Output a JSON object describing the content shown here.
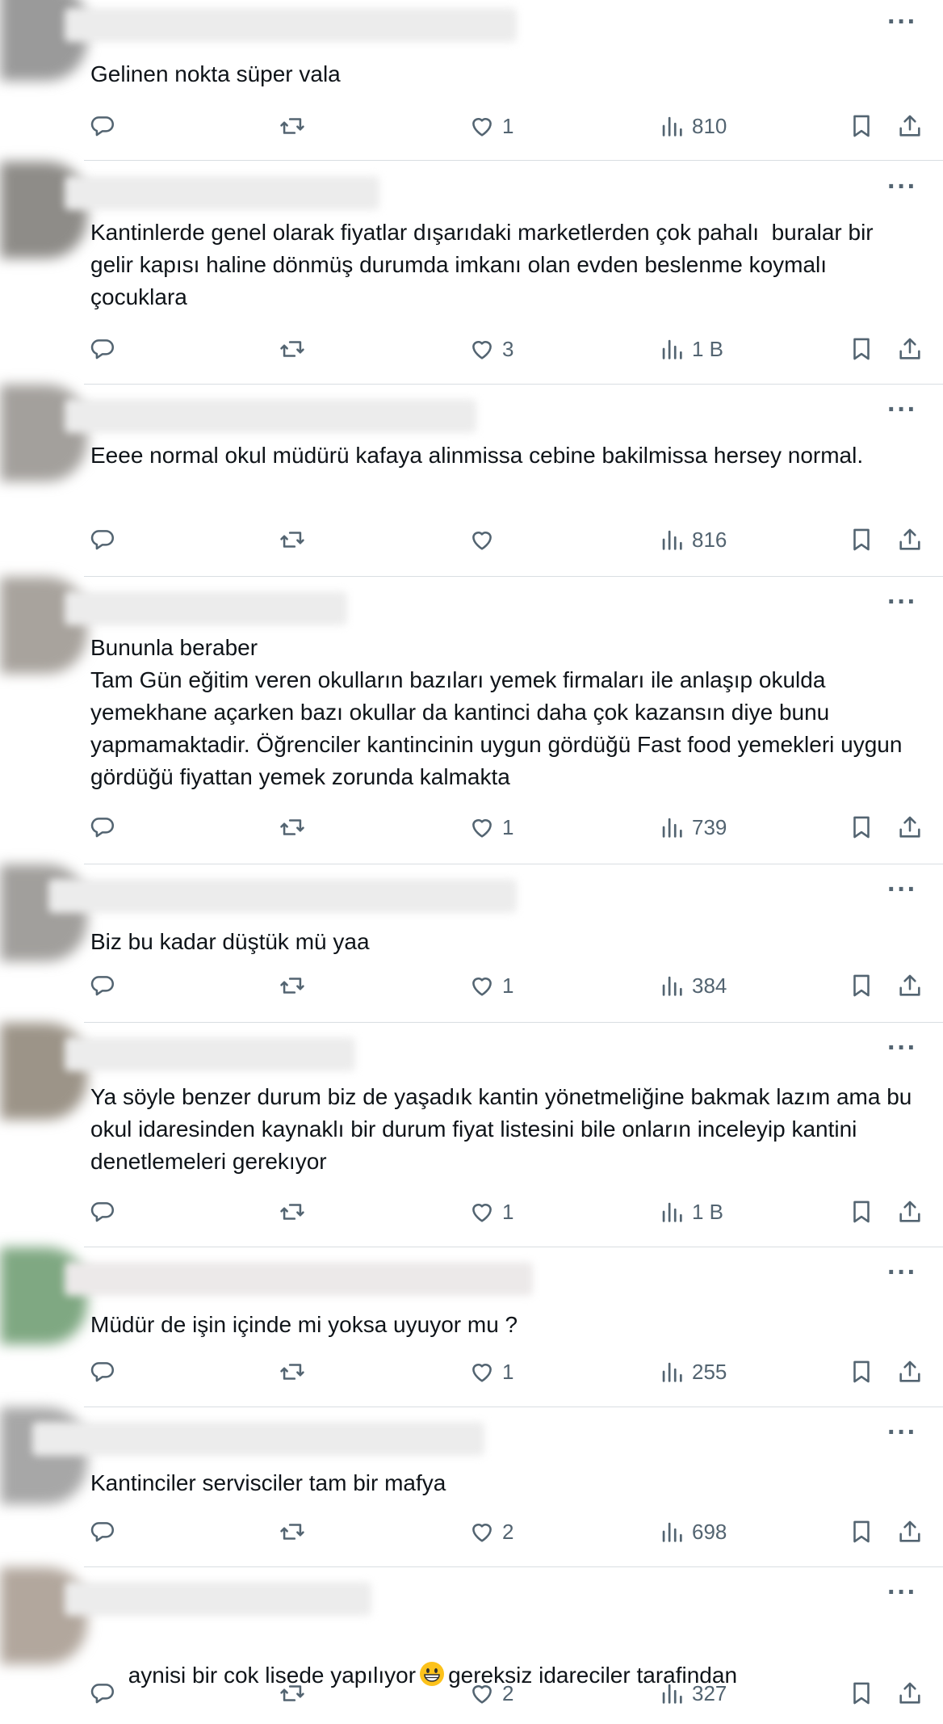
{
  "icons": {
    "more": "more-options-icon",
    "reply": "reply-icon",
    "retweet": "retweet-icon",
    "like": "heart-icon",
    "views": "views-icon",
    "bookmark": "bookmark-icon",
    "share": "share-icon"
  },
  "colors": {
    "text": "#0f1419",
    "muted": "#536471",
    "divider": "#d9dee2"
  },
  "more_label": "···",
  "tweets": [
    {
      "text": "Gelinen nokta süper vala",
      "likes": "1",
      "views": "810"
    },
    {
      "text": "Kantinlerde genel olarak fiyatlar dışarıdaki marketlerden çok pahalı  buralar bir gelir kapısı haline dönmüş durumda imkanı olan evden beslenme koymalı çocuklara",
      "likes": "3",
      "views": "1 B"
    },
    {
      "text": "Eeee normal okul müdürü kafaya alinmissa cebine bakilmissa hersey normal.",
      "likes": "",
      "views": "816"
    },
    {
      "text": "Bununla beraber\nTam Gün eğitim veren okulların bazıları yemek firmaları ile anlaşıp okulda yemekhane açarken bazı okullar da kantinci daha çok kazansın diye bunu yapmamaktadir. Öğrenciler kantincinin uygun gördüğü Fast food yemekleri uygun gördüğü fiyattan yemek zorunda kalmakta",
      "likes": "1",
      "views": "739"
    },
    {
      "text": "Biz bu kadar düştük mü yaa",
      "likes": "1",
      "views": "384"
    },
    {
      "text": "Ya söyle benzer durum biz de yaşadık kantin yönetmeliğine bakmak lazım ama bu okul idaresinden kaynaklı bir durum fiyat listesini bile onların inceleyip kantini denetlemeleri gerekıyor",
      "likes": "1",
      "views": "1 B"
    },
    {
      "text": "Müdür de işin içinde mi yoksa uyuyor mu ?",
      "likes": "1",
      "views": "255"
    },
    {
      "text": "Kantinciler servisciler tam bir mafya",
      "likes": "2",
      "views": "698"
    },
    {
      "text_before": "aynisi bir cok lisede yapılıyor",
      "text_after": "gereksiz idareciler tarafindan",
      "likes": "2",
      "views": "327"
    }
  ]
}
